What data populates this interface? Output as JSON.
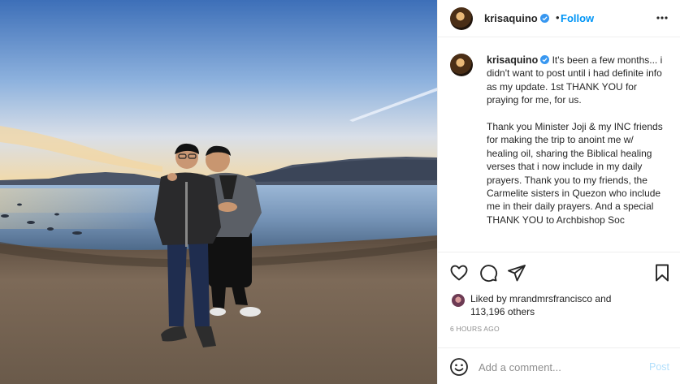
{
  "post": {
    "username": "krisaquino",
    "verified": true,
    "follow_label": "Follow",
    "separator": "•",
    "more_icon": "more-horizontal-icon"
  },
  "caption": {
    "username": "krisaquino",
    "paragraph_1": "It's been a few months... i didn't want to post until i had definite info as my update. 1st THANK YOU for praying for me, for us.",
    "paragraph_2": "Thank you Minister Joji & my INC friends for making the trip to anoint me w/ healing oil, sharing the Biblical healing verses that i now include in my daily prayers. Thank you to my friends, the Carmelite sisters in Quezon who include me in their daily prayers. And a special THANK YOU to Archbishop Soc"
  },
  "actions": {
    "like_icon": "heart-icon",
    "comment_icon": "comment-icon",
    "share_icon": "share-icon",
    "save_icon": "bookmark-icon"
  },
  "likes": {
    "prefix": "Liked by",
    "liker": "mrandmrsfrancisco",
    "joiner": "and",
    "count": "113,196 others"
  },
  "timestamp": "6 HOURS AGO",
  "comment_box": {
    "placeholder": "Add a comment...",
    "post_label": "Post",
    "emoji_icon": "emoji-icon"
  },
  "colors": {
    "accent": "#0095f6",
    "verified": "#3897f0",
    "muted": "#8e8e8e",
    "post_disabled": "#b2dffc"
  }
}
